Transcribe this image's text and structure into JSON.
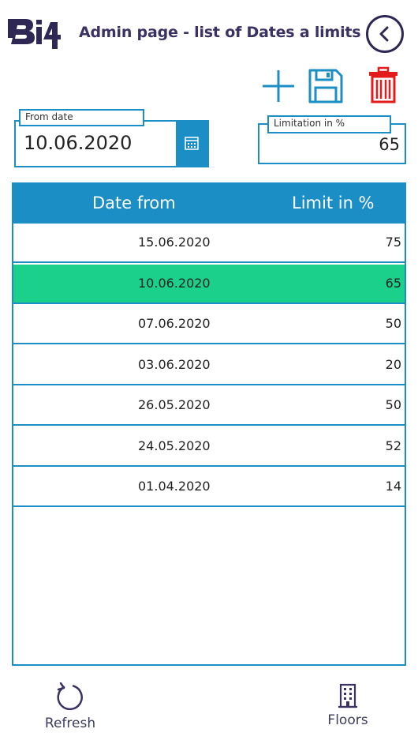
{
  "header": {
    "logo_text": "Bi4",
    "title": "Admin page - list of Dates a limits"
  },
  "toolbar": {
    "add_icon": "plus-icon",
    "save_icon": "save-icon",
    "delete_icon": "trash-icon"
  },
  "form": {
    "from_date": {
      "label": "From date",
      "value": "10.06.2020"
    },
    "limitation": {
      "label": "Limitation in %",
      "value": "65"
    }
  },
  "table": {
    "columns": [
      "Date from",
      "Limit in %"
    ],
    "rows": [
      {
        "date": "15.06.2020",
        "limit": "75",
        "selected": false
      },
      {
        "date": "10.06.2020",
        "limit": "65",
        "selected": true
      },
      {
        "date": "07.06.2020",
        "limit": "50",
        "selected": false
      },
      {
        "date": "03.06.2020",
        "limit": "20",
        "selected": false
      },
      {
        "date": "26.05.2020",
        "limit": "50",
        "selected": false
      },
      {
        "date": "24.05.2020",
        "limit": "52",
        "selected": false
      },
      {
        "date": "01.04.2020",
        "limit": "14",
        "selected": false
      }
    ]
  },
  "bottom_bar": {
    "refresh_label": "Refresh",
    "floors_label": "Floors"
  },
  "colors": {
    "accent": "#1b8fc5",
    "selected_row": "#1ad08a",
    "delete": "#e31b1b",
    "title": "#3b3163"
  }
}
